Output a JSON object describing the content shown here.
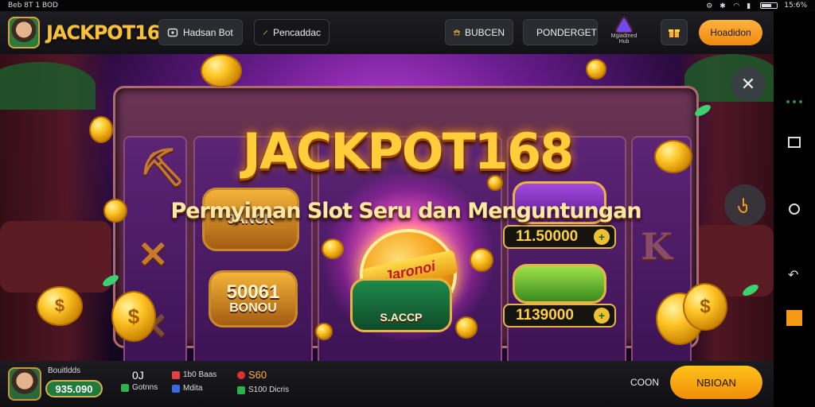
{
  "status_bar": {
    "time_text": "Beb 8T 1 BOD",
    "battery_text": "15:6%"
  },
  "header": {
    "logo_text": "JACKPOT168",
    "btn_1": "Hadsan Bot",
    "btn_2": "Pencaddac",
    "btn_3": "BUBCEN",
    "btn_4": "PONDERGET",
    "brand_caption": "Mgiadmed Hub",
    "primary_btn": "Hoadidon"
  },
  "game": {
    "title": "JACKPOT168",
    "subtitle": "Permyiman Slot Seru dan Menguntungan",
    "chest_1": "JANCK",
    "chest_2_top": "50061",
    "chest_2_bottom": "BONOU",
    "jackpot_ribbon": "Jaronoi",
    "chest_green": "S.ACCP",
    "prize_1": "11.50000",
    "prize_2": "1139000",
    "prize_plus": "+",
    "coin_symbol": "$",
    "close_icon_glyph": "✕"
  },
  "footer": {
    "player_name": "Bouitldds",
    "balance": "935.090",
    "stat_1_value": "0J",
    "stat_1_label": "Gotnns",
    "stat_2_label": "1b0 Baas",
    "stat_2_sub": "Mdita",
    "stat_3_label": "S60",
    "stat_3_sub": "S100 Dicris",
    "text_right": "COON",
    "cta": "NBIOAN"
  },
  "colors": {
    "accent_orange": "#f59a14",
    "gold": "#ffce3a",
    "stage_purple": "#6a1d8f"
  },
  "icons": [
    "bot-icon",
    "pencil-icon",
    "bank-icon",
    "coupon-icon",
    "brand-triangle-icon",
    "gift-icon",
    "close-icon",
    "hand-tap-icon",
    "back-icon",
    "home-icon",
    "recents-icon"
  ]
}
